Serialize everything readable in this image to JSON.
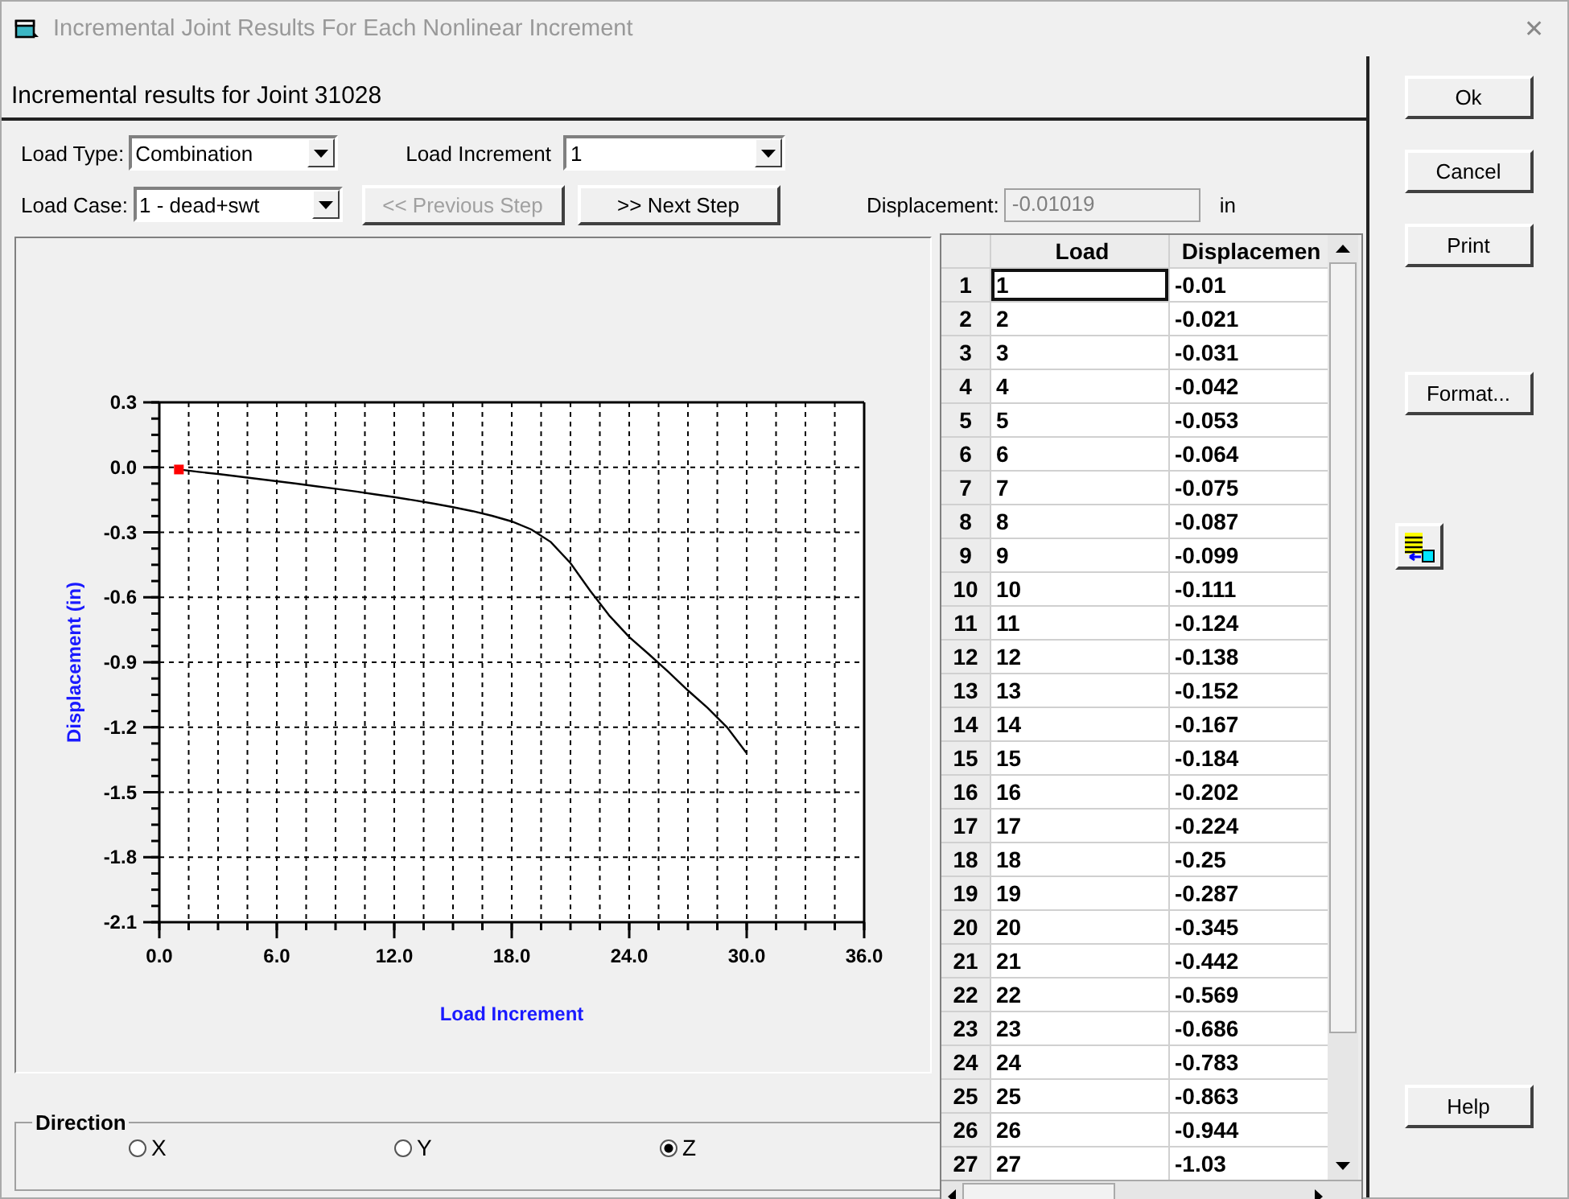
{
  "window": {
    "title": "Incremental Joint Results For Each Nonlinear Increment",
    "close": "✕"
  },
  "header": "Incremental results for Joint 31028",
  "load_type": {
    "label": "Load Type:",
    "value": "Combination"
  },
  "load_increment": {
    "label": "Load Increment",
    "value": "1"
  },
  "load_case": {
    "label": "Load Case:",
    "value": "1 - dead+swt"
  },
  "step_buttons": [
    {
      "label": "<< Previous Step",
      "disabled": true
    },
    {
      "label": ">> Next Step",
      "disabled": false
    }
  ],
  "displacement": {
    "label": "Displacement:",
    "value": "-0.01019",
    "unit": "in",
    "disabled": true
  },
  "chart": {
    "chart_data": {
      "type": "line",
      "xlabel": "Load Increment",
      "ylabel": "Displacement (in)",
      "x": [
        1,
        2,
        3,
        4,
        5,
        6,
        7,
        8,
        9,
        10,
        11,
        12,
        13,
        14,
        15,
        16,
        17,
        18,
        19,
        20,
        21,
        22,
        23,
        24,
        25,
        26,
        27,
        28,
        29,
        30
      ],
      "grid": true,
      "series": [
        {
          "color": "#000000",
          "values": [
            -0.01,
            -0.021,
            -0.031,
            -0.042,
            -0.053,
            -0.064,
            -0.075,
            -0.087,
            -0.099,
            -0.111,
            -0.124,
            -0.138,
            -0.152,
            -0.167,
            -0.184,
            -0.202,
            -0.224,
            -0.25,
            -0.287,
            -0.345,
            -0.442,
            -0.569,
            -0.686,
            -0.783,
            -0.863,
            -0.944,
            -1.03,
            -1.11,
            -1.2,
            -1.32
          ]
        }
      ],
      "xlim": [
        0,
        36
      ],
      "ylim": [
        -2.1,
        0.3
      ],
      "xticks": [
        {
          "value": 0,
          "label": "0.0"
        },
        {
          "value": 6,
          "label": "6.0"
        },
        {
          "value": 12,
          "label": "12.0"
        },
        {
          "value": 18,
          "label": "18.0"
        },
        {
          "value": 24,
          "label": "24.0"
        },
        {
          "value": 30,
          "label": "30.0"
        },
        {
          "value": 36,
          "label": "36.0"
        }
      ],
      "yticks": [
        {
          "value": 0.3,
          "label": "0.3"
        },
        {
          "value": 0,
          "label": "0.0"
        },
        {
          "value": -0.3,
          "label": "-0.3"
        },
        {
          "value": -0.6,
          "label": "-0.6"
        },
        {
          "value": -0.9,
          "label": "-0.9"
        },
        {
          "value": -1.2,
          "label": "-1.2"
        },
        {
          "value": -1.5,
          "label": "-1.5"
        },
        {
          "value": -1.8,
          "label": "-1.8"
        },
        {
          "value": -2.1,
          "label": "-2.1"
        }
      ]
    }
  },
  "table": {
    "columns": [
      "Load",
      "Displacemen"
    ],
    "rows": [
      {
        "index": "1",
        "load": "1",
        "displacement": "-0.01",
        "selected": true
      },
      {
        "index": "2",
        "load": "2",
        "displacement": "-0.021",
        "selected": false
      },
      {
        "index": "3",
        "load": "3",
        "displacement": "-0.031",
        "selected": false
      },
      {
        "index": "4",
        "load": "4",
        "displacement": "-0.042",
        "selected": false
      },
      {
        "index": "5",
        "load": "5",
        "displacement": "-0.053",
        "selected": false
      },
      {
        "index": "6",
        "load": "6",
        "displacement": "-0.064",
        "selected": false
      },
      {
        "index": "7",
        "load": "7",
        "displacement": "-0.075",
        "selected": false
      },
      {
        "index": "8",
        "load": "8",
        "displacement": "-0.087",
        "selected": false
      },
      {
        "index": "9",
        "load": "9",
        "displacement": "-0.099",
        "selected": false
      },
      {
        "index": "10",
        "load": "10",
        "displacement": "-0.111",
        "selected": false
      },
      {
        "index": "11",
        "load": "11",
        "displacement": "-0.124",
        "selected": false
      },
      {
        "index": "12",
        "load": "12",
        "displacement": "-0.138",
        "selected": false
      },
      {
        "index": "13",
        "load": "13",
        "displacement": "-0.152",
        "selected": false
      },
      {
        "index": "14",
        "load": "14",
        "displacement": "-0.167",
        "selected": false
      },
      {
        "index": "15",
        "load": "15",
        "displacement": "-0.184",
        "selected": false
      },
      {
        "index": "16",
        "load": "16",
        "displacement": "-0.202",
        "selected": false
      },
      {
        "index": "17",
        "load": "17",
        "displacement": "-0.224",
        "selected": false
      },
      {
        "index": "18",
        "load": "18",
        "displacement": "-0.25",
        "selected": false
      },
      {
        "index": "19",
        "load": "19",
        "displacement": "-0.287",
        "selected": false
      },
      {
        "index": "20",
        "load": "20",
        "displacement": "-0.345",
        "selected": false
      },
      {
        "index": "21",
        "load": "21",
        "displacement": "-0.442",
        "selected": false
      },
      {
        "index": "22",
        "load": "22",
        "displacement": "-0.569",
        "selected": false
      },
      {
        "index": "23",
        "load": "23",
        "displacement": "-0.686",
        "selected": false
      },
      {
        "index": "24",
        "load": "24",
        "displacement": "-0.783",
        "selected": false
      },
      {
        "index": "25",
        "load": "25",
        "displacement": "-0.863",
        "selected": false
      },
      {
        "index": "26",
        "load": "26",
        "displacement": "-0.944",
        "selected": false
      },
      {
        "index": "27",
        "load": "27",
        "displacement": "-1.03",
        "selected": false
      }
    ]
  },
  "direction": {
    "title": "Direction",
    "options": [
      {
        "label": "X",
        "selected": false
      },
      {
        "label": "Y",
        "selected": false
      },
      {
        "label": "Z",
        "selected": true
      }
    ]
  },
  "buttons": [
    "Ok",
    "Cancel",
    "Print",
    "Format..."
  ],
  "help": "Help"
}
